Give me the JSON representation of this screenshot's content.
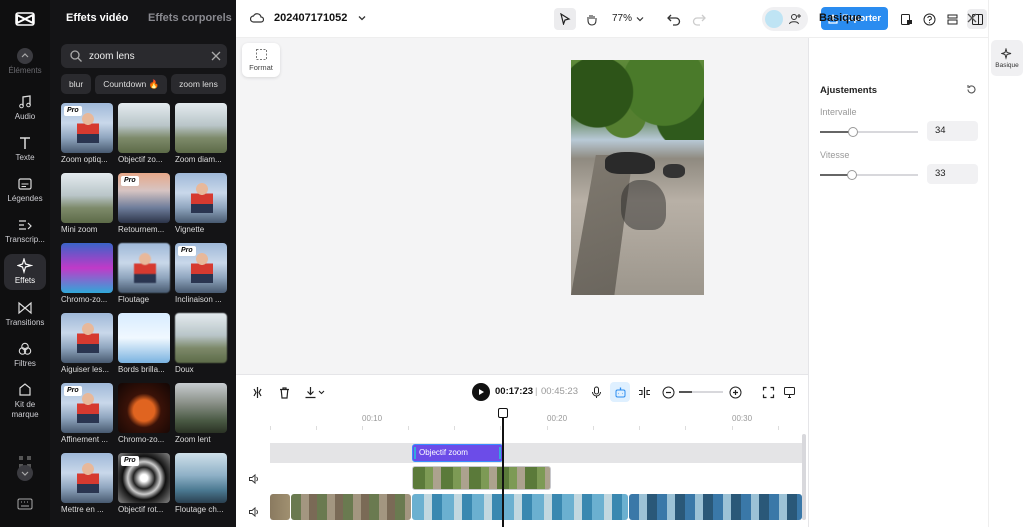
{
  "rail": {
    "items": [
      {
        "label": "Éléments"
      },
      {
        "label": "Audio"
      },
      {
        "label": "Texte"
      },
      {
        "label": "Légendes"
      },
      {
        "label": "Transcrip..."
      },
      {
        "label": "Effets"
      },
      {
        "label": "Transitions"
      },
      {
        "label": "Filtres"
      },
      {
        "label": "Kit de marque"
      }
    ]
  },
  "effects_panel": {
    "tabs": [
      "Effets vidéo",
      "Effets corporels"
    ],
    "search": {
      "value": "zoom lens"
    },
    "chips": [
      "blur",
      "Countdown 🔥",
      "zoom lens"
    ],
    "pro_label": "Pro",
    "cards": [
      {
        "label": "Zoom optiq...",
        "pro": true
      },
      {
        "label": "Objectif zo...",
        "pro": false
      },
      {
        "label": "Zoom diam...",
        "pro": false
      },
      {
        "label": "Mini zoom",
        "pro": false
      },
      {
        "label": "Retournem...",
        "pro": true
      },
      {
        "label": "Vignette",
        "pro": false
      },
      {
        "label": "Chromo-zo...",
        "pro": false
      },
      {
        "label": "Floutage",
        "pro": false
      },
      {
        "label": "Inclinaison ...",
        "pro": true
      },
      {
        "label": "Aiguiser les...",
        "pro": false
      },
      {
        "label": "Bords brilla...",
        "pro": false
      },
      {
        "label": "Doux",
        "pro": false
      },
      {
        "label": "Affinement ...",
        "pro": true
      },
      {
        "label": "Chromo-zo...",
        "pro": false
      },
      {
        "label": "Zoom lent",
        "pro": false
      },
      {
        "label": "Mettre en ...",
        "pro": false
      },
      {
        "label": "Objectif rot...",
        "pro": true
      },
      {
        "label": "Floutage ch...",
        "pro": false
      }
    ]
  },
  "topbar": {
    "project_name": "202407171052",
    "zoom": "77%",
    "export_label": "Exporter"
  },
  "canvas": {
    "format_label": "Format"
  },
  "timeline": {
    "current_time": "00:17:23",
    "separator": "|",
    "duration": "00:45:23",
    "zoom_level": 0.3,
    "ruler": [
      "00:10",
      "00:20",
      "00:30"
    ],
    "effect_clip_label": "Objectif zoom"
  },
  "properties": {
    "title": "Basique",
    "section": "Ajustements",
    "params": [
      {
        "label": "Intervalle",
        "value": "34",
        "fraction": 0.34
      },
      {
        "label": "Vitesse",
        "value": "33",
        "fraction": 0.33
      }
    ]
  },
  "right_rail": {
    "basique_label": "Basique"
  },
  "colors": {
    "accent": "#2a8cf0",
    "effect_clip": "#6c4ce8",
    "dark_panel": "#141416"
  }
}
